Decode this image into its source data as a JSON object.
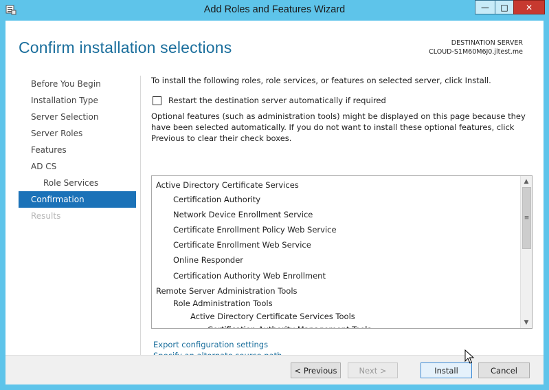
{
  "window": {
    "title": "Add Roles and Features Wizard",
    "controls": {
      "minimize": "—",
      "maximize": "□",
      "close": "✕"
    }
  },
  "header": {
    "page_title": "Confirm installation selections",
    "destination_label": "DESTINATION SERVER",
    "destination_server": "CLOUD-S1M60M6J0.jltest.me"
  },
  "nav": {
    "items": [
      {
        "label": "Before You Begin",
        "state": "normal"
      },
      {
        "label": "Installation Type",
        "state": "normal"
      },
      {
        "label": "Server Selection",
        "state": "normal"
      },
      {
        "label": "Server Roles",
        "state": "normal"
      },
      {
        "label": "Features",
        "state": "normal"
      },
      {
        "label": "AD CS",
        "state": "normal"
      },
      {
        "label": "Role Services",
        "state": "sub"
      },
      {
        "label": "Confirmation",
        "state": "active"
      },
      {
        "label": "Results",
        "state": "disabled"
      }
    ]
  },
  "content": {
    "intro": "To install the following roles, role services, or features on selected server, click Install.",
    "restart_label": "Restart the destination server automatically if required",
    "restart_checked": false,
    "optional_note": "Optional features (such as administration tools) might be displayed on this page because they have been selected automatically. If you do not want to install these optional features, click Previous to clear their check boxes.",
    "selections": [
      {
        "text": "Active Directory Certificate Services",
        "level": 0
      },
      {
        "text": "Certification Authority",
        "level": 1
      },
      {
        "text": "Network Device Enrollment Service",
        "level": 1
      },
      {
        "text": "Certificate Enrollment Policy Web Service",
        "level": 1
      },
      {
        "text": "Certificate Enrollment Web Service",
        "level": 1
      },
      {
        "text": "Online Responder",
        "level": 1
      },
      {
        "text": "Certification Authority Web Enrollment",
        "level": 1
      },
      {
        "text": "Remote Server Administration Tools",
        "level": 0
      },
      {
        "text": "Role Administration Tools",
        "level": 1
      },
      {
        "text": "Active Directory Certificate Services Tools",
        "level": 2
      },
      {
        "text": "Certification Authority Management Tools",
        "level": 3
      }
    ],
    "export_link": "Export configuration settings",
    "alternate_link": "Specify an alternate source path"
  },
  "buttons": {
    "previous": "< Previous",
    "next": "Next >",
    "install": "Install",
    "cancel": "Cancel"
  }
}
